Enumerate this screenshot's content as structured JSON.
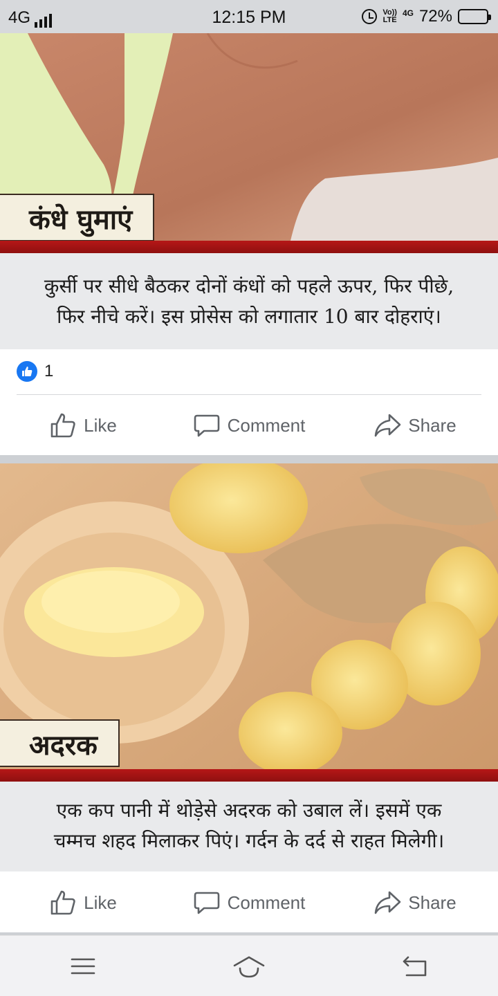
{
  "status_bar": {
    "network": "4G",
    "time": "12:15 PM",
    "volte": "Vo))",
    "lte": "LTE",
    "network_right": "4G",
    "battery": "72%",
    "battery_level": 0.72
  },
  "posts": [
    {
      "tag": "कंधे घुमाएं",
      "caption_lines": [
        "कुर्सी पर सीधे बैठकर दोनों कंधों को पहले ऊपर, फिर पीछे,",
        "फिर नीचे करें। इस प्रोसेस को लगातार 10 बार दोहराएं।"
      ],
      "reaction_count": "1",
      "actions": {
        "like": "Like",
        "comment": "Comment",
        "share": "Share"
      }
    },
    {
      "tag": "अदरक",
      "caption_lines": [
        "एक कप पानी में थोड़ेसे अदरक को उबाल लें। इसमें एक",
        "चम्मच शहद मिलाकर पिएं। गर्दन के दर्द से राहत मिलेगी।"
      ],
      "actions": {
        "like": "Like",
        "comment": "Comment",
        "share": "Share"
      }
    }
  ],
  "nav_bar": {
    "icons": [
      "menu-icon",
      "home-icon",
      "back-icon"
    ]
  },
  "colors": {
    "brand_blue": "#1877f2",
    "banner_red": "#b51717",
    "action_gray": "#5f6368"
  }
}
